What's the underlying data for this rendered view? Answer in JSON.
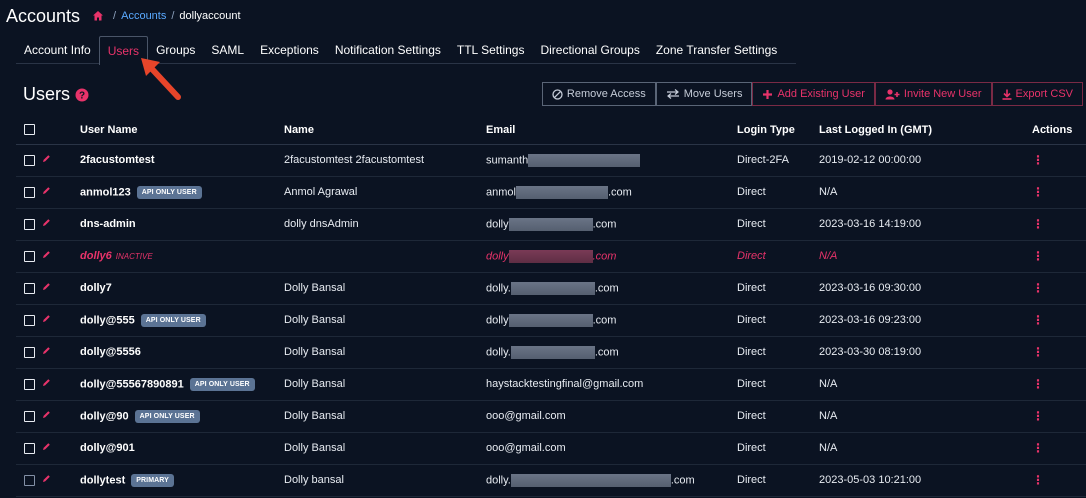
{
  "header": {
    "title": "Accounts",
    "home_icon": "home-icon",
    "breadcrumb": [
      "Accounts",
      "dollyaccount"
    ]
  },
  "tabs": [
    {
      "label": "Account Info",
      "active": false
    },
    {
      "label": "Users",
      "active": true
    },
    {
      "label": "Groups",
      "active": false
    },
    {
      "label": "SAML",
      "active": false
    },
    {
      "label": "Exceptions",
      "active": false
    },
    {
      "label": "Notification Settings",
      "active": false
    },
    {
      "label": "TTL Settings",
      "active": false
    },
    {
      "label": "Directional Groups",
      "active": false
    },
    {
      "label": "Zone Transfer Settings",
      "active": false
    }
  ],
  "section": {
    "title": "Users",
    "help_icon": "help-circle-icon"
  },
  "toolbar": {
    "remove_access": "Remove Access",
    "move_users": "Move Users",
    "add_existing_user": "Add Existing User",
    "invite_new_user": "Invite New User",
    "export_csv": "Export CSV"
  },
  "table": {
    "columns": [
      "User Name",
      "Name",
      "Email",
      "Login Type",
      "Last Logged In (GMT)",
      "Actions"
    ],
    "rows": [
      {
        "username": "2facustomtest",
        "badge": "",
        "status": "",
        "name": "2facustomtest 2facustomtest",
        "email_prefix": "sumanth",
        "email_suffix": "",
        "login_type": "Direct-2FA",
        "last_login": "2019-02-12 00:00:00"
      },
      {
        "username": "anmol123",
        "badge": "API ONLY USER",
        "status": "",
        "name": "Anmol Agrawal",
        "email_prefix": "anmol",
        "email_suffix": ".com",
        "login_type": "Direct",
        "last_login": "N/A"
      },
      {
        "username": "dns-admin",
        "badge": "",
        "status": "",
        "name": "dolly dnsAdmin",
        "email_prefix": "dolly",
        "email_suffix": ".com",
        "login_type": "Direct",
        "last_login": "2023-03-16 14:19:00"
      },
      {
        "username": "dolly6",
        "badge": "",
        "status": "INACTIVE",
        "name": "",
        "email_prefix": "dolly",
        "email_suffix": ".com",
        "login_type": "Direct",
        "last_login": "N/A"
      },
      {
        "username": "dolly7",
        "badge": "",
        "status": "",
        "name": "Dolly Bansal",
        "email_prefix": "dolly.",
        "email_suffix": ".com",
        "login_type": "Direct",
        "last_login": "2023-03-16 09:30:00"
      },
      {
        "username": "dolly@555",
        "badge": "API ONLY USER",
        "status": "",
        "name": "Dolly Bansal",
        "email_prefix": "dolly",
        "email_suffix": ".com",
        "login_type": "Direct",
        "last_login": "2023-03-16 09:23:00"
      },
      {
        "username": "dolly@5556",
        "badge": "",
        "status": "",
        "name": "Dolly Bansal",
        "email_prefix": "dolly.",
        "email_suffix": ".com",
        "login_type": "Direct",
        "last_login": "2023-03-30 08:19:00"
      },
      {
        "username": "dolly@55567890891",
        "badge": "API ONLY USER",
        "status": "",
        "name": "Dolly Bansal",
        "email_prefix": "haystacktestingfinal@gmail.com",
        "email_suffix": "",
        "login_type": "Direct",
        "last_login": "N/A"
      },
      {
        "username": "dolly@90",
        "badge": "API ONLY USER",
        "status": "",
        "name": "Dolly Bansal",
        "email_prefix": "ooo@gmail.com",
        "email_suffix": "",
        "login_type": "Direct",
        "last_login": "N/A"
      },
      {
        "username": "dolly@901",
        "badge": "",
        "status": "",
        "name": "Dolly Bansal",
        "email_prefix": "ooo@gmail.com",
        "email_suffix": "",
        "login_type": "Direct",
        "last_login": "N/A"
      },
      {
        "username": "dollytest",
        "badge": "PRIMARY",
        "status": "",
        "name": "Dolly bansal",
        "email_prefix": "dolly.",
        "email_suffix": ".com",
        "login_type": "Direct",
        "last_login": "2023-05-03 10:21:00"
      }
    ]
  },
  "colors": {
    "accent": "#e8336a",
    "link": "#5aa9ff",
    "background": "#0b1322",
    "badge": "#5b7394"
  }
}
